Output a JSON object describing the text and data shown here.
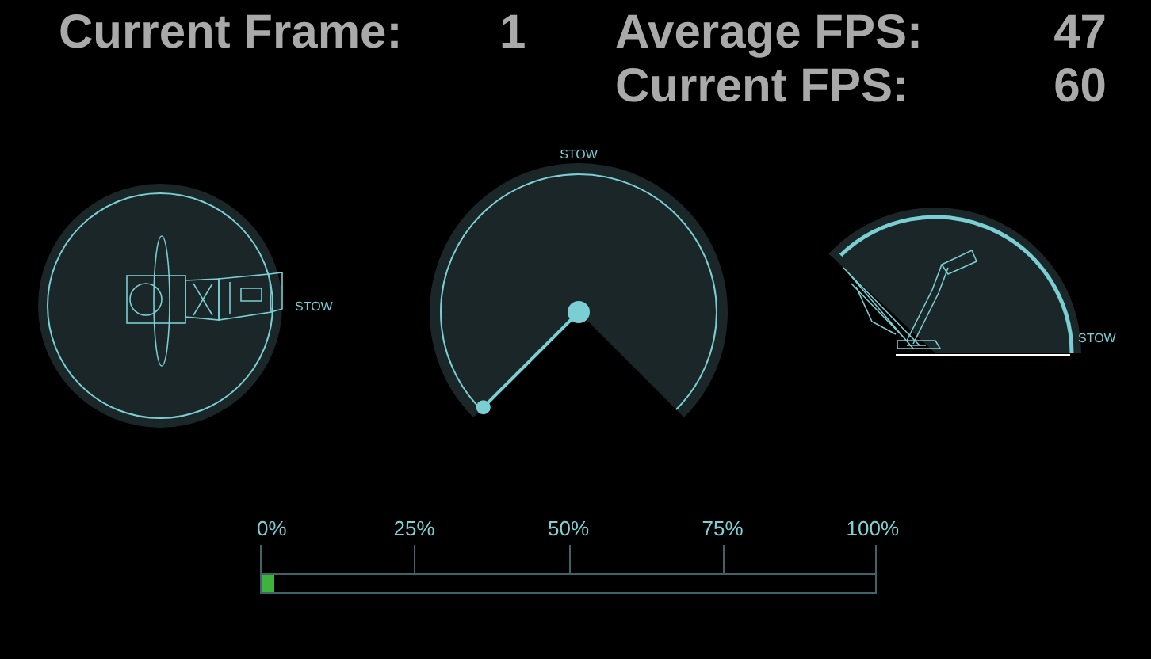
{
  "stats": [
    {
      "label": "Current Frame:",
      "value": "1"
    },
    {
      "label": "Average FPS:",
      "value": "47"
    },
    {
      "label": "Current FPS:",
      "value": "60"
    }
  ],
  "gauges": [
    {
      "kind": "top",
      "label": "STOW"
    },
    {
      "kind": "dial",
      "label": "STOW"
    },
    {
      "kind": "side",
      "label": "STOW"
    }
  ],
  "progress": {
    "ticks": [
      "0%",
      "25%",
      "50%",
      "75%",
      "100%"
    ],
    "level": 0.02
  }
}
